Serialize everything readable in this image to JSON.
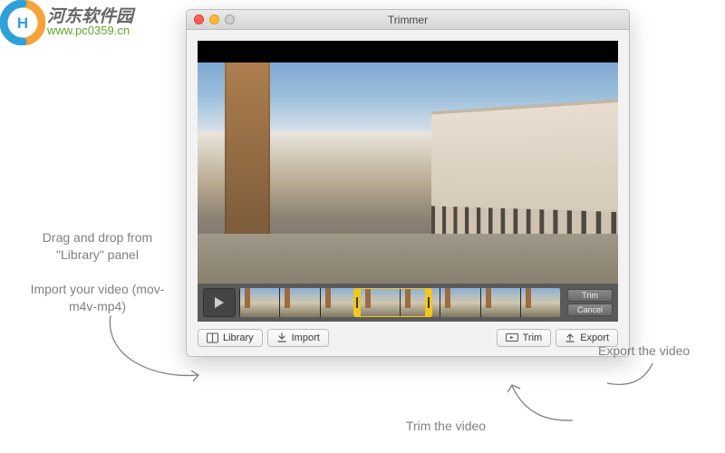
{
  "watermark": {
    "cn": "河东软件园",
    "url": "www.pc0359.cn"
  },
  "window": {
    "title": "Trimmer"
  },
  "trimBar": {
    "trimLabel": "Trim",
    "cancelLabel": "Cancel"
  },
  "toolbar": {
    "library": "Library",
    "import": "Import",
    "trim": "Trim",
    "export": "Export"
  },
  "callouts": {
    "dragDrop": "Drag and drop from \"Library\" panel",
    "importVideo": "Import your video (mov-m4v-mp4)",
    "exportVideo": "Export the video",
    "trimVideo": "Trim the video"
  }
}
